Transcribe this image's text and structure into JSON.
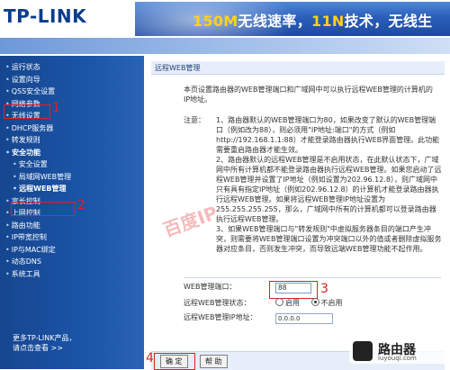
{
  "header": {
    "logo": "TP-LINK",
    "banner_text_1": "150M",
    "banner_text_2": "无线速率，",
    "banner_text_3": "11N",
    "banner_text_4": "技术，",
    "banner_text_5": "无线生"
  },
  "sidebar": {
    "items": [
      {
        "label": "运行状态"
      },
      {
        "label": "设置向导"
      },
      {
        "label": "QSS安全设置"
      },
      {
        "label": "网络参数"
      },
      {
        "label": "无线设置"
      },
      {
        "label": "DHCP服务器"
      },
      {
        "label": "转发规则"
      },
      {
        "label": "安全功能"
      },
      {
        "label": "安全设置"
      },
      {
        "label": "局域网WEB管理"
      },
      {
        "label": "远程WEB管理"
      },
      {
        "label": "家长控制"
      },
      {
        "label": "上网控制"
      },
      {
        "label": "路由功能"
      },
      {
        "label": "IP带宽控制"
      },
      {
        "label": "IP与MAC绑定"
      },
      {
        "label": "动态DNS"
      },
      {
        "label": "系统工具"
      }
    ],
    "footer_line1": "更多TP-LINK产品，",
    "footer_line2": "请点击查看 >>"
  },
  "annotations": {
    "n1": "1",
    "n2": "2",
    "n3": "3",
    "n4": "4"
  },
  "content": {
    "title": "远程WEB管理",
    "description": "本页设置路由器的WEB管理端口和广域网中可以执行远程WEB管理的计算机的IP地址。",
    "notes_label": "注意：",
    "note1": "1、路由器默认的WEB管理端口为80，如果改变了默认的WEB管理端口（例如改为88），则必须用\"IP地址:端口\"的方式（例如http://192.168.1.1:88）才能登录路由器执行WEB界面管理。此功能需要重启路由器才能生效。",
    "note2": "2、路由器默认的远程WEB管理是不启用状态，在此默认状态下，广域网中所有计算机都不能登录路由器执行远程WEB管理。如果您启动了远程WEB管理并设置了IP地址（例如设置为202.96.12.8），则广域网中只有具有指定IP地址（例如202.96.12.8）的计算机才能登录路由器执行远程WEB管理。如果将远程WEB管理IP地址设置为255.255.255.255，那么，广域网中所有的计算机都可以登录路由器执行远程WEB管理。",
    "note3": "3、如果WEB管理端口与\"转发规则\"中虚拟服务器条目的端口产生冲突，则需要将WEB管理端口设置为冲突端口以外的值或者删除虚拟服务器对应条目，否则发生冲突，而导致远端WEB管理功能不起作用。",
    "port_label": "WEB管理端口：",
    "port_value": "88",
    "status_label": "远程WEB管理状态：",
    "status_option_on": "启用",
    "status_option_off": "不启用",
    "ip_label": "远程WEB管理IP地址：",
    "ip_value": "0.0.0.0",
    "ok_button": "确 定",
    "help_button": "帮 助"
  },
  "watermark": "百度IP",
  "corner_logo": {
    "title": "路由器",
    "subtitle": "luyouqi.com"
  }
}
